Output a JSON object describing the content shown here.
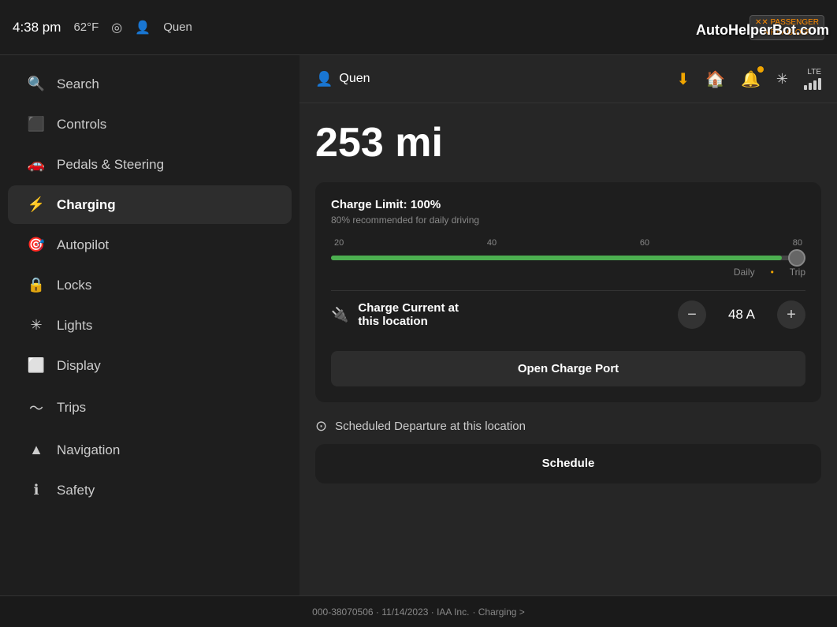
{
  "statusBar": {
    "time": "4:38 pm",
    "temperature": "62°F",
    "userName": "Quen",
    "passengerBadge": "PASSENGER\nAIRBAG OFF",
    "watermark": "AutoHelperBot.com"
  },
  "sidebar": {
    "items": [
      {
        "id": "search",
        "label": "Search",
        "icon": "🔍"
      },
      {
        "id": "controls",
        "label": "Controls",
        "icon": "⬜"
      },
      {
        "id": "pedals",
        "label": "Pedals & Steering",
        "icon": "🚗"
      },
      {
        "id": "charging",
        "label": "Charging",
        "icon": "⚡",
        "active": true
      },
      {
        "id": "autopilot",
        "label": "Autopilot",
        "icon": "🎯"
      },
      {
        "id": "locks",
        "label": "Locks",
        "icon": "🔒"
      },
      {
        "id": "lights",
        "label": "Lights",
        "icon": "💡"
      },
      {
        "id": "display",
        "label": "Display",
        "icon": "🖥"
      },
      {
        "id": "trips",
        "label": "Trips",
        "icon": "📊"
      },
      {
        "id": "navigation",
        "label": "Navigation",
        "icon": "🔺"
      },
      {
        "id": "safety",
        "label": "Safety",
        "icon": "ℹ️"
      }
    ]
  },
  "mainHeader": {
    "userName": "Quen",
    "userIcon": "👤"
  },
  "chargingPanel": {
    "rangeValue": "253 mi",
    "chargeCard": {
      "chargeLimitLabel": "Charge Limit: 100%",
      "recommendation": "80% recommended for daily driving",
      "sliderMarks": [
        "20",
        "40",
        "60",
        "80"
      ],
      "sliderFillPercent": 95,
      "dailyLabel": "Daily",
      "tripLabel": "Trip"
    },
    "chargeCurrentLabel": "Charge Current at\nthis location",
    "chargeCurrentValue": "48 A",
    "decreaseBtn": "−",
    "increaseBtn": "+",
    "openChargePortBtn": "Open Charge Port",
    "scheduledDepartureLabel": "Scheduled Departure at this location",
    "scheduleBtn": "Schedule"
  },
  "footer": {
    "text": "000-38070506 · 11/14/2023 · IAA Inc."
  }
}
